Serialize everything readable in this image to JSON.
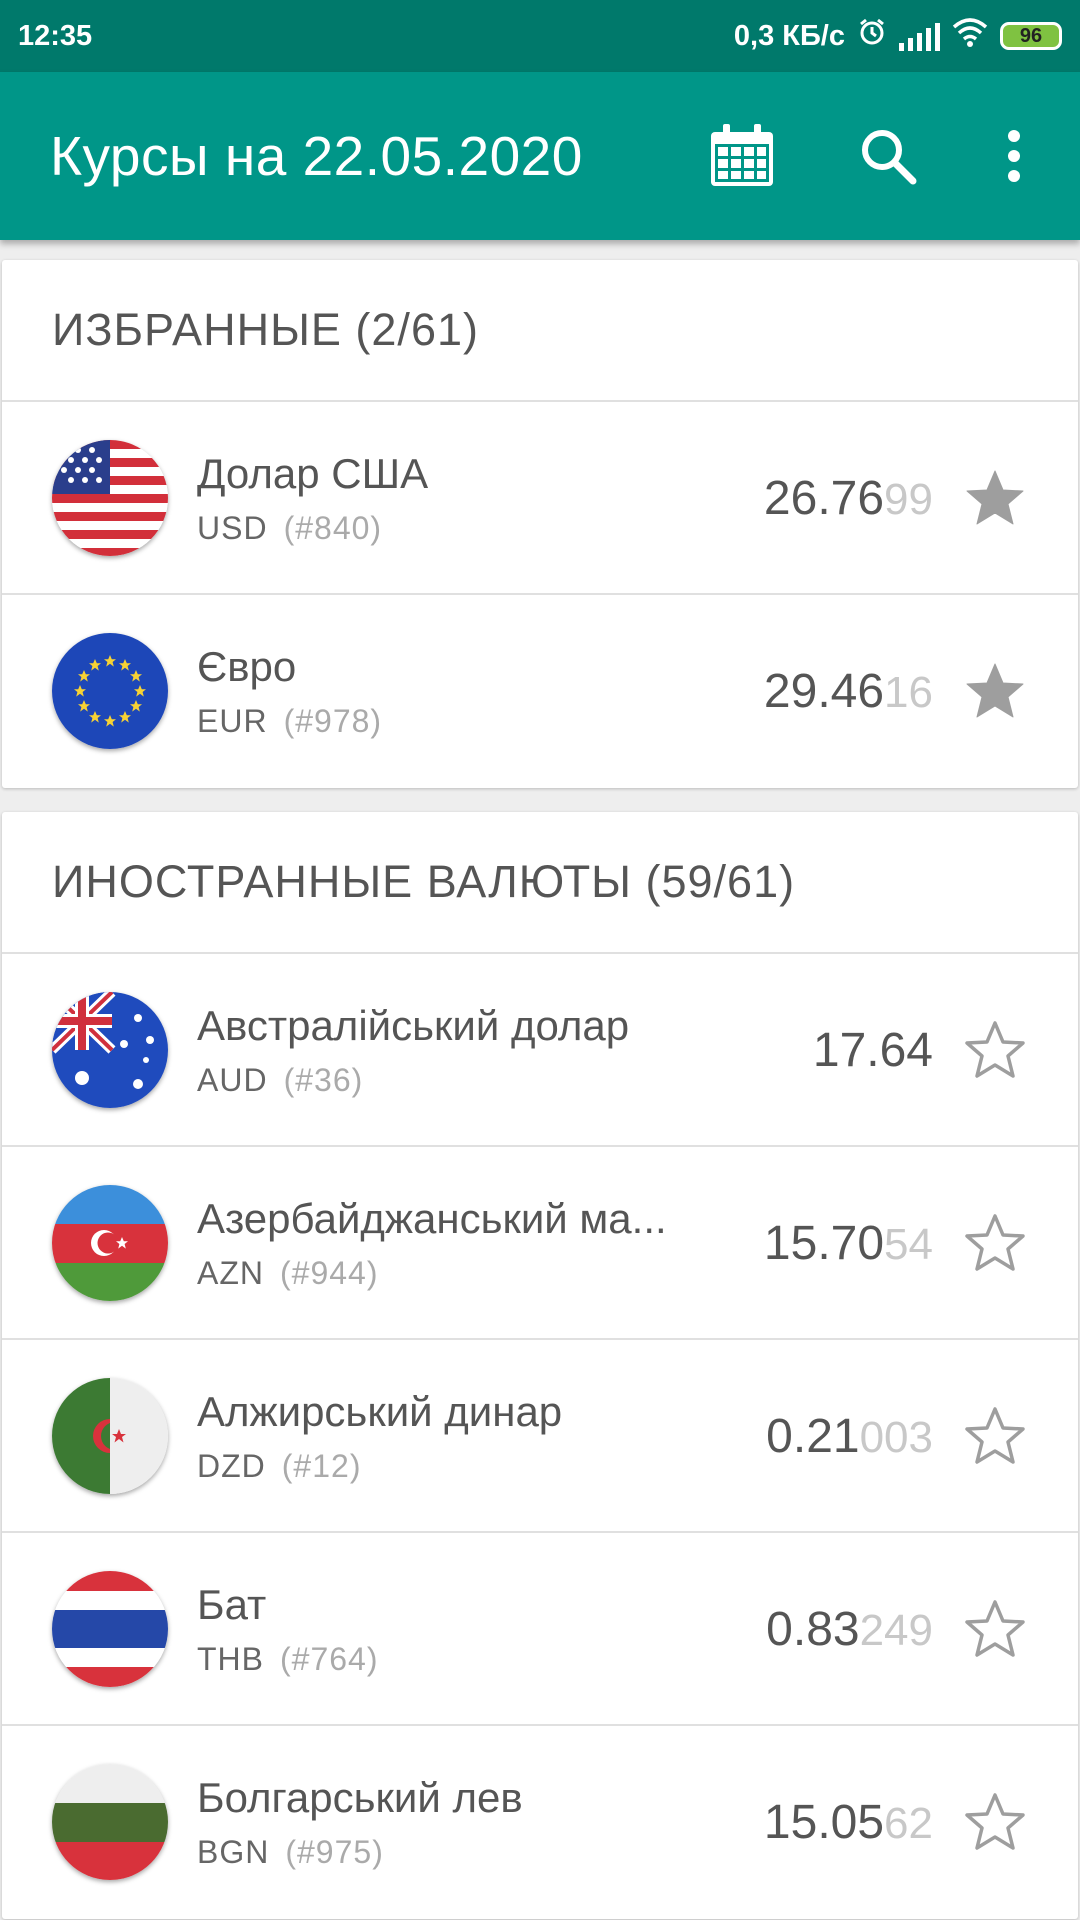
{
  "status_bar": {
    "time": "12:35",
    "speed": "0,3 КБ/с",
    "battery": "96"
  },
  "app_bar": {
    "title": "Курсы на 22.05.2020",
    "icons": [
      "calendar-icon",
      "search-icon",
      "more-vert-icon"
    ]
  },
  "colors": {
    "status_bar": "#00796b",
    "app_bar": "#009688",
    "star_filled": "#9e9e9e",
    "background": "#eeeeee"
  },
  "sections": [
    {
      "title": "ИЗБРАННЫЕ (2/61)",
      "items": [
        {
          "flag": "us",
          "name": "Долар США",
          "code": "USD",
          "num": "(#840)",
          "rate_main": "26.76",
          "rate_extra": "99",
          "favorite": true
        },
        {
          "flag": "eu",
          "name": "Євро",
          "code": "EUR",
          "num": "(#978)",
          "rate_main": "29.46",
          "rate_extra": "16",
          "favorite": true
        }
      ]
    },
    {
      "title": "ИНОСТРАННЫЕ ВАЛЮТЫ (59/61)",
      "items": [
        {
          "flag": "au",
          "name": "Австралійський долар",
          "code": "AUD",
          "num": "(#36)",
          "rate_main": "17.64",
          "rate_extra": "",
          "favorite": false
        },
        {
          "flag": "az",
          "name": "Азербайджанський ма...",
          "code": "AZN",
          "num": "(#944)",
          "rate_main": "15.70",
          "rate_extra": "54",
          "favorite": false
        },
        {
          "flag": "dz",
          "name": "Алжирський динар",
          "code": "DZD",
          "num": "(#12)",
          "rate_main": "0.21",
          "rate_extra": "003",
          "favorite": false
        },
        {
          "flag": "th",
          "name": "Бат",
          "code": "THB",
          "num": "(#764)",
          "rate_main": "0.83",
          "rate_extra": "249",
          "favorite": false
        },
        {
          "flag": "bg",
          "name": "Болгарський лев",
          "code": "BGN",
          "num": "(#975)",
          "rate_main": "15.05",
          "rate_extra": "62",
          "favorite": false
        }
      ]
    }
  ]
}
